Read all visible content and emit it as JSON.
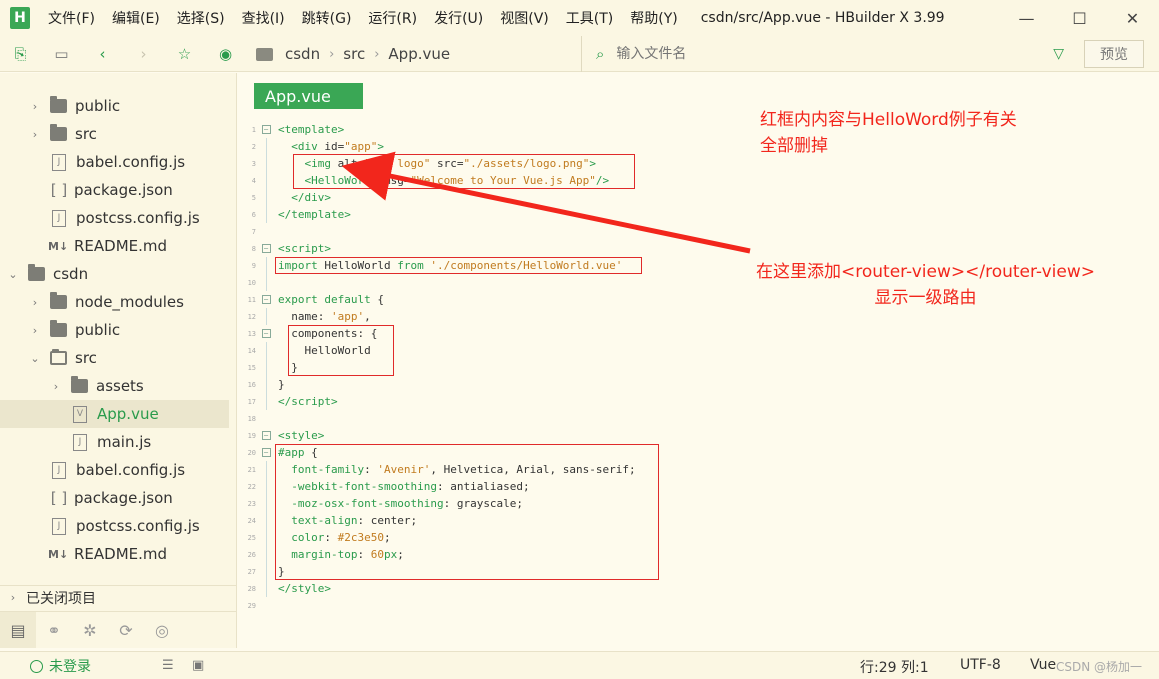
{
  "app": {
    "logo": "H",
    "menu": [
      "文件(F)",
      "编辑(E)",
      "选择(S)",
      "查找(I)",
      "跳转(G)",
      "运行(R)",
      "发行(U)",
      "视图(V)",
      "工具(T)",
      "帮助(Y)"
    ],
    "window_title": "csdn/src/App.vue - HBuilder X 3.99",
    "controls": [
      "—",
      "☐",
      "✕"
    ]
  },
  "toolbar": {
    "breadcrumb": [
      "csdn",
      "src",
      "App.vue"
    ],
    "file_search_placeholder": "输入文件名",
    "preview_label": "预览"
  },
  "sidebar": {
    "items": [
      {
        "label": "public",
        "type": "folder",
        "indent": 1,
        "chevron": "›"
      },
      {
        "label": "src",
        "type": "folder",
        "indent": 1,
        "chevron": "›"
      },
      {
        "label": "babel.config.js",
        "type": "js",
        "indent": 1
      },
      {
        "label": "package.json",
        "type": "json",
        "indent": 1
      },
      {
        "label": "postcss.config.js",
        "type": "js",
        "indent": 1
      },
      {
        "label": "README.md",
        "type": "md",
        "indent": 1
      },
      {
        "label": "csdn",
        "type": "project",
        "indent": 0,
        "chevron": "⌄"
      },
      {
        "label": "node_modules",
        "type": "folder",
        "indent": 1,
        "chevron": "›"
      },
      {
        "label": "public",
        "type": "folder",
        "indent": 1,
        "chevron": "›"
      },
      {
        "label": "src",
        "type": "folder-open",
        "indent": 1,
        "chevron": "⌄"
      },
      {
        "label": "assets",
        "type": "folder",
        "indent": 2,
        "chevron": "›"
      },
      {
        "label": "App.vue",
        "type": "vue",
        "indent": 2,
        "selected": true
      },
      {
        "label": "main.js",
        "type": "js",
        "indent": 2
      },
      {
        "label": "babel.config.js",
        "type": "js",
        "indent": 1
      },
      {
        "label": "package.json",
        "type": "json",
        "indent": 1
      },
      {
        "label": "postcss.config.js",
        "type": "js",
        "indent": 1
      },
      {
        "label": "README.md",
        "type": "md",
        "indent": 1
      }
    ],
    "closed_projects": "已关闭项目",
    "bottom_tabs": [
      "project-tab",
      "search-tab",
      "debug-tab",
      "plugin-tab",
      "web-tab"
    ]
  },
  "editor": {
    "tab_label": "App.vue",
    "lines": [
      {
        "n": "1",
        "fold": "box",
        "html": "<span class=\"k\">&lt;template&gt;</span>"
      },
      {
        "n": "2",
        "fold": "line",
        "html": "  <span class=\"k\">&lt;div</span> <span class=\"p\">id=</span><span class=\"s\">\"app\"</span><span class=\"k\">&gt;</span>"
      },
      {
        "n": "3",
        "fold": "line",
        "html": "    <span class=\"k\">&lt;img</span> <span class=\"p\">alt=</span><span class=\"s\">\"Vue logo\"</span> <span class=\"p\">src=</span><span class=\"s\">\"./assets/logo.png\"</span><span class=\"k\">&gt;</span>"
      },
      {
        "n": "4",
        "fold": "line",
        "html": "    <span class=\"k\">&lt;HelloWorld</span> <span class=\"p\">msg=</span><span class=\"s\">\"Welcome to Your Vue.js App\"</span><span class=\"k\">/&gt;</span>"
      },
      {
        "n": "5",
        "fold": "line",
        "html": "  <span class=\"k\">&lt;/div&gt;</span>"
      },
      {
        "n": "6",
        "fold": "line",
        "html": "<span class=\"k\">&lt;/template&gt;</span>"
      },
      {
        "n": "7",
        "fold": "",
        "html": ""
      },
      {
        "n": "8",
        "fold": "box",
        "html": "<span class=\"k\">&lt;script&gt;</span>"
      },
      {
        "n": "9",
        "fold": "line",
        "html": "<span class=\"k\">import</span> HelloWorld <span class=\"k\">from</span> <span class=\"s\">'./components/HelloWorld.vue'</span>"
      },
      {
        "n": "10",
        "fold": "line",
        "html": ""
      },
      {
        "n": "11",
        "fold": "box",
        "html": "<span class=\"k\">export default</span> {"
      },
      {
        "n": "12",
        "fold": "line",
        "html": "  name: <span class=\"s\">'app'</span>,"
      },
      {
        "n": "13",
        "fold": "box",
        "html": "  components: {"
      },
      {
        "n": "14",
        "fold": "line",
        "html": "    HelloWorld"
      },
      {
        "n": "15",
        "fold": "line",
        "html": "  }"
      },
      {
        "n": "16",
        "fold": "line",
        "html": "}"
      },
      {
        "n": "17",
        "fold": "line",
        "html": "<span class=\"k\">&lt;/script&gt;</span>"
      },
      {
        "n": "18",
        "fold": "",
        "html": ""
      },
      {
        "n": "19",
        "fold": "box",
        "html": "<span class=\"k\">&lt;style&gt;</span>"
      },
      {
        "n": "20",
        "fold": "box",
        "html": "<span class=\"k\">#app</span> {"
      },
      {
        "n": "21",
        "fold": "line",
        "html": "  <span class=\"k\">font-family</span>: <span class=\"s\">'Avenir'</span>, Helvetica, Arial, sans-serif;"
      },
      {
        "n": "22",
        "fold": "line",
        "html": "  <span class=\"k\">-webkit-font-smoothing</span>: antialiased;"
      },
      {
        "n": "23",
        "fold": "line",
        "html": "  <span class=\"k\">-moz-osx-font-smoothing</span>: grayscale;"
      },
      {
        "n": "24",
        "fold": "line",
        "html": "  <span class=\"k\">text-align</span>: center;"
      },
      {
        "n": "25",
        "fold": "line",
        "html": "  <span class=\"k\">color</span>: <span class=\"n\">#2c3e50</span>;"
      },
      {
        "n": "26",
        "fold": "line",
        "html": "  <span class=\"k\">margin-top</span>: <span class=\"n\">60</span><span class=\"k\">px</span>;"
      },
      {
        "n": "27",
        "fold": "line",
        "html": "}"
      },
      {
        "n": "28",
        "fold": "line",
        "html": "<span class=\"k\">&lt;/style&gt;</span>"
      },
      {
        "n": "29",
        "fold": "",
        "html": ""
      }
    ],
    "annotation_1": [
      "红框内内容与HelloWord例子有关",
      "全部删掉"
    ],
    "annotation_2": [
      "在这里添加<router-view></router-view>",
      "显示一级路由"
    ],
    "annotation_color": "#f2261c"
  },
  "status": {
    "login": "未登录",
    "position": "行:29  列:1",
    "encoding": "UTF-8",
    "language": "Vue",
    "watermark": "CSDN @杨加一"
  }
}
